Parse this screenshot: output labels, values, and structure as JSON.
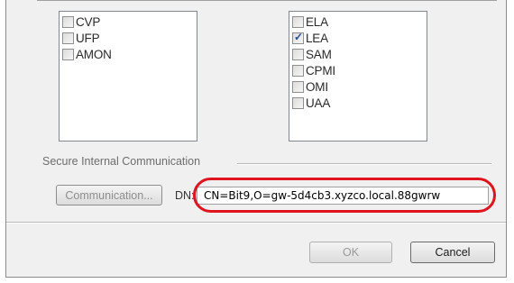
{
  "left_list": {
    "items": [
      {
        "label": "CVP",
        "checked": false
      },
      {
        "label": "UFP",
        "checked": false
      },
      {
        "label": "AMON",
        "checked": false
      }
    ]
  },
  "right_list": {
    "items": [
      {
        "label": "ELA",
        "checked": false
      },
      {
        "label": "LEA",
        "checked": true
      },
      {
        "label": "SAM",
        "checked": false
      },
      {
        "label": "CPMI",
        "checked": false
      },
      {
        "label": "OMI",
        "checked": false
      },
      {
        "label": "UAA",
        "checked": false
      }
    ]
  },
  "sic": {
    "group_label": "Secure Internal Communication",
    "communication_button": "Communication...",
    "dn_label": "DN:",
    "dn_value": "CN=Bit9,O=gw-5d4cb3.xyzco.local.88gwrw"
  },
  "footer": {
    "ok_label": "OK",
    "cancel_label": "Cancel"
  },
  "colors": {
    "annotation": "#e0141e",
    "dialog_bg": "#f0f0f0",
    "check_mark": "#2a4a8c"
  }
}
